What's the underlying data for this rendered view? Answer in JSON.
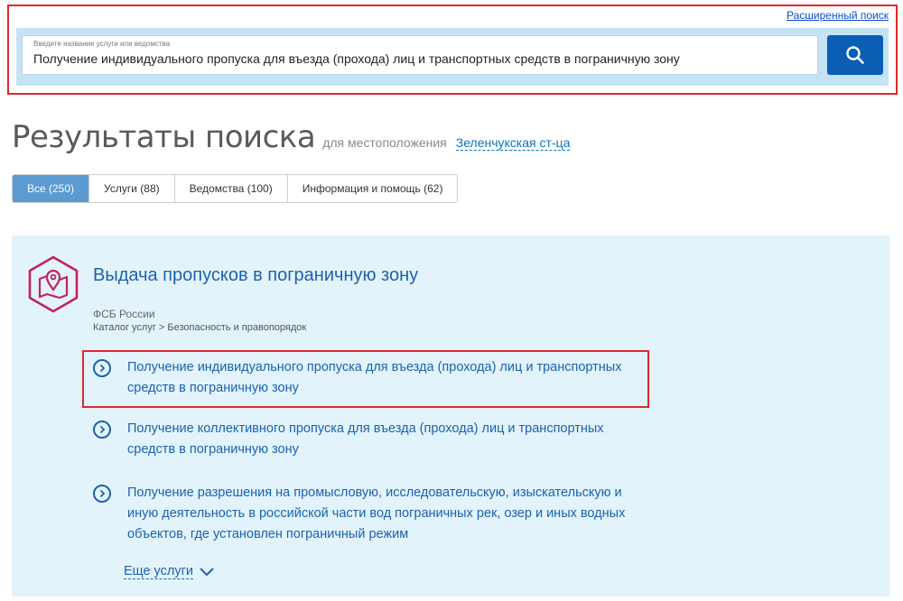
{
  "header": {
    "advanced_search_label": "Расширенный поиск",
    "search": {
      "hint": "Введите название услуги или ведомства",
      "value": "Получение индивидуального пропуска для въезда (прохода) лиц и транспортных средств в пограничную зону",
      "button_icon": "search-icon"
    }
  },
  "results": {
    "title": "Результаты поиска",
    "location_prefix": "для местоположения",
    "location": "Зеленчукская ст-ца"
  },
  "tabs": [
    {
      "label": "Все (250)",
      "active": true
    },
    {
      "label": "Услуги (88)",
      "active": false
    },
    {
      "label": "Ведомства (100)",
      "active": false
    },
    {
      "label": "Информация и помощь (62)",
      "active": false
    }
  ],
  "category": {
    "icon": "map-pin-icon",
    "title": "Выдача пропусков в пограничную зону",
    "org": "ФСБ России",
    "breadcrumb": "Каталог услуг > Безопасность и правопорядок",
    "services": [
      {
        "label": "Получение индивидуального пропуска для въезда (прохода) лиц и транспортных средств в пограничную зону",
        "highlighted": true
      },
      {
        "label": "Получение коллективного пропуска для въезда (прохода) лиц и транспортных средств в пограничную зону",
        "highlighted": false
      },
      {
        "label": "Получение разрешения на промысловую, исследовательскую, изыскательскую и иную деятельность в российской части вод пограничных рек, озер и иных водных объектов, где установлен пограничный режим",
        "highlighted": false
      }
    ],
    "more_label": "Еще услуги"
  },
  "colors": {
    "accent": "#1a62b0",
    "search_band": "#c5e3f6",
    "panel_bg": "#e3f3fb",
    "active_tab": "#5b9bd1",
    "highlight_border": "#e0282e",
    "icon_color": "#c3245a"
  }
}
